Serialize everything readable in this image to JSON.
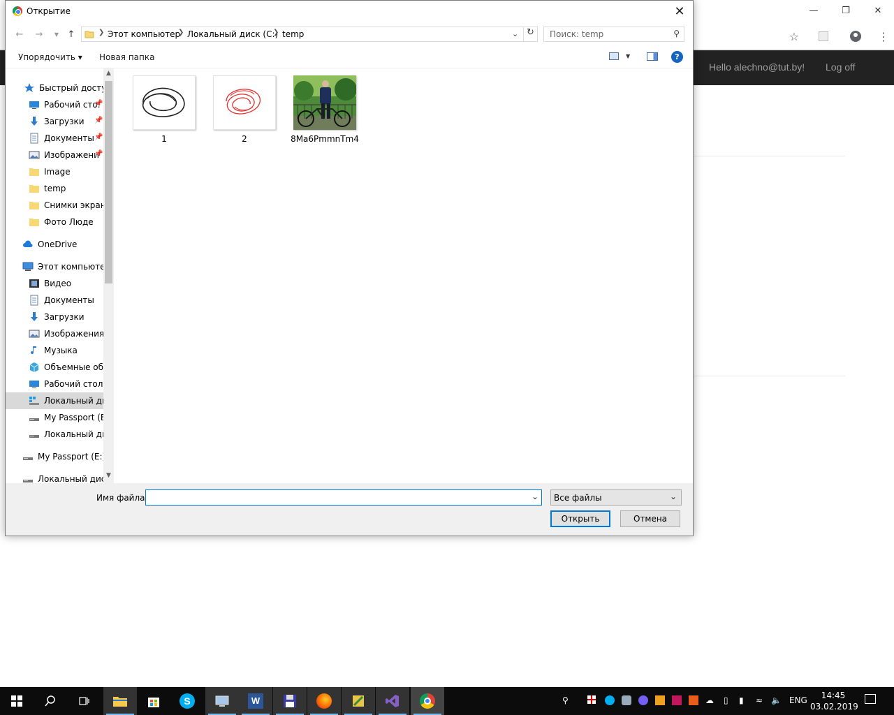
{
  "browser": {
    "nav_user": "Hello alechno@tut.by!",
    "nav_logoff": "Log off"
  },
  "dialog": {
    "title": "Открытие",
    "breadcrumb": [
      "Этот компьютер",
      "Локальный диск (C:)",
      "temp"
    ],
    "search_placeholder": "Поиск: temp",
    "toolbar": {
      "organize_label": "Упорядочить ▾",
      "new_folder_label": "Новая папка"
    },
    "sidebar": {
      "items": [
        {
          "label": "Быстрый доступ",
          "icon": "star-icon"
        },
        {
          "label": "Рабочий сто.",
          "icon": "desktop-icon",
          "pinned": true
        },
        {
          "label": "Загрузки",
          "icon": "download-icon",
          "pinned": true
        },
        {
          "label": "Документы",
          "icon": "document-icon",
          "pinned": true
        },
        {
          "label": "Изображени",
          "icon": "pictures-icon",
          "pinned": true
        },
        {
          "label": "Image",
          "icon": "folder-icon"
        },
        {
          "label": "temp",
          "icon": "folder-icon"
        },
        {
          "label": "Снимки экрана",
          "icon": "folder-icon"
        },
        {
          "label": "Фото Люде",
          "icon": "folder-icon"
        },
        {
          "label": "OneDrive",
          "icon": "cloud-icon"
        },
        {
          "label": "Этот компьютер",
          "icon": "computer-icon"
        },
        {
          "label": "Видео",
          "icon": "video-icon"
        },
        {
          "label": "Документы",
          "icon": "document-icon"
        },
        {
          "label": "Загрузки",
          "icon": "download-icon"
        },
        {
          "label": "Изображения",
          "icon": "pictures-icon"
        },
        {
          "label": "Музыка",
          "icon": "music-icon"
        },
        {
          "label": "Объемные объ",
          "icon": "cube-icon"
        },
        {
          "label": "Рабочий стол",
          "icon": "desktop-icon"
        },
        {
          "label": "Локальный дис",
          "icon": "windows-drive-icon",
          "selected": true
        },
        {
          "label": "My Passport (E:)",
          "icon": "drive-icon"
        },
        {
          "label": "Локальный дис",
          "icon": "drive-icon"
        },
        {
          "label": "My Passport (E:)",
          "icon": "drive-icon"
        },
        {
          "label": "Локальный диск",
          "icon": "drive-icon"
        }
      ]
    },
    "files": [
      {
        "name": "1",
        "kind": "black-scribble"
      },
      {
        "name": "2",
        "kind": "red-scribble"
      },
      {
        "name": "8Ma6PmmnTm4",
        "kind": "photo-bicycle"
      }
    ],
    "filename_label": "Имя файла:",
    "filename_value": "",
    "file_type": "Все файлы",
    "open_label": "Открыть",
    "cancel_label": "Отмена"
  },
  "taskbar": {
    "lang": "ENG",
    "time": "14:45",
    "date": "03.02.2019",
    "apps": [
      "start-icon",
      "search-icon",
      "task-view-icon",
      "file-explorer-icon",
      "store-icon",
      "skype-icon",
      "remote-desktop-icon",
      "word-icon",
      "save-icon",
      "firefox-icon",
      "archive-icon",
      "visual-studio-icon",
      "chrome-icon"
    ]
  }
}
